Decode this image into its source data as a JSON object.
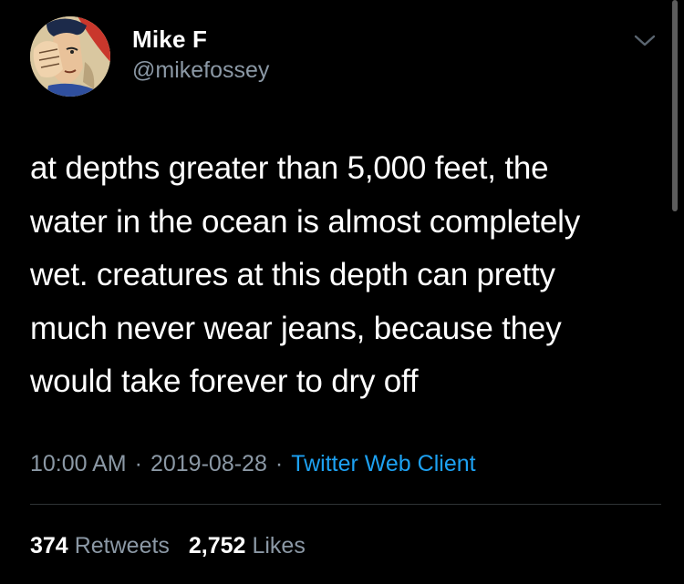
{
  "tweet": {
    "author": {
      "display_name": "Mike F",
      "handle": "@mikefossey",
      "avatar_icon": "comic-superman-avatar"
    },
    "caret_icon": "chevron-down-icon",
    "text": "at depths greater than 5,000 feet, the\nwater in the ocean is almost completely\nwet. creatures at this depth can pretty\nmuch never wear jeans, because they\nwould take forever to dry off",
    "time": "10:00 AM",
    "date": "2019-08-28",
    "separator": "·",
    "client": "Twitter Web Client",
    "stats": {
      "retweets_count": "374",
      "retweets_label": "Retweets",
      "likes_count": "2,752",
      "likes_label": "Likes"
    }
  },
  "colors": {
    "background": "#000000",
    "primary_text": "#ffffff",
    "secondary_text": "#8b98a5",
    "link": "#1da1f2",
    "divider": "#2f3336"
  }
}
